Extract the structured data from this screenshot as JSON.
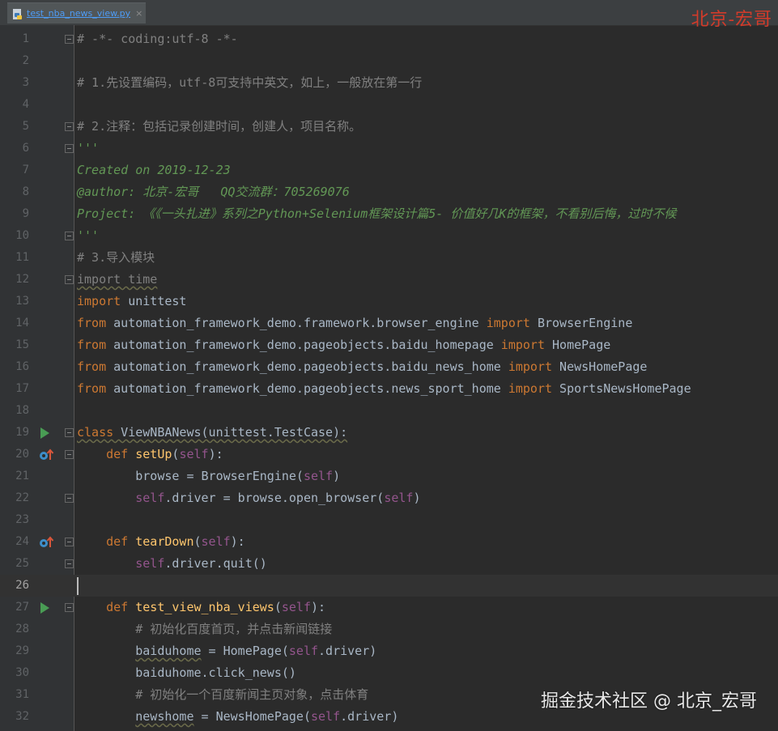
{
  "tab": {
    "title": "test_nba_news_view.py",
    "close": "×"
  },
  "watermark_top": "北京-宏哥",
  "watermark_bottom": "掘金技术社区 @ 北京_宏哥",
  "lines": [
    {
      "num": "1",
      "tokens": [
        {
          "t": "# -*- coding:utf-8 -*-",
          "c": "cm"
        }
      ]
    },
    {
      "num": "2",
      "tokens": []
    },
    {
      "num": "3",
      "tokens": [
        {
          "t": "# 1.先设置编码，utf-8可支持中英文，如上，一般放在第一行",
          "c": "cm"
        }
      ]
    },
    {
      "num": "4",
      "tokens": []
    },
    {
      "num": "5",
      "tokens": [
        {
          "t": "# 2.注释：包括记录创建时间，创建人，项目名称。",
          "c": "cm"
        }
      ]
    },
    {
      "num": "6",
      "tokens": [
        {
          "t": "'''",
          "c": "doc"
        }
      ]
    },
    {
      "num": "7",
      "tokens": [
        {
          "t": "Created on 2019-12-23",
          "c": "doc"
        }
      ]
    },
    {
      "num": "8",
      "tokens": [
        {
          "t": "@author: 北京-宏哥   QQ交流群：705269076",
          "c": "doc"
        }
      ]
    },
    {
      "num": "9",
      "tokens": [
        {
          "t": "Project: 《《一头扎进》系列之Python+Selenium框架设计篇5- 价值好几K的框架，不看别后悔，过时不候",
          "c": "doc"
        }
      ]
    },
    {
      "num": "10",
      "tokens": [
        {
          "t": "'''",
          "c": "doc"
        }
      ]
    },
    {
      "num": "11",
      "tokens": [
        {
          "t": "# 3.导入模块",
          "c": "cm"
        }
      ]
    },
    {
      "num": "12",
      "tokens": [
        {
          "t": "import time",
          "c": "cm wavy"
        }
      ]
    },
    {
      "num": "13",
      "tokens": [
        {
          "t": "import",
          "c": "kw"
        },
        {
          "t": " unittest",
          "c": "txt"
        }
      ]
    },
    {
      "num": "14",
      "tokens": [
        {
          "t": "from",
          "c": "kw"
        },
        {
          "t": " automation_framework_demo.framework.browser_engine ",
          "c": "txt"
        },
        {
          "t": "import",
          "c": "kw"
        },
        {
          "t": " BrowserEngine",
          "c": "txt"
        }
      ]
    },
    {
      "num": "15",
      "tokens": [
        {
          "t": "from",
          "c": "kw"
        },
        {
          "t": " automation_framework_demo.pageobjects.baidu_homepage ",
          "c": "txt"
        },
        {
          "t": "import",
          "c": "kw"
        },
        {
          "t": " HomePage",
          "c": "txt"
        }
      ]
    },
    {
      "num": "16",
      "tokens": [
        {
          "t": "from",
          "c": "kw"
        },
        {
          "t": " automation_framework_demo.pageobjects.baidu_news_home ",
          "c": "txt"
        },
        {
          "t": "import",
          "c": "kw"
        },
        {
          "t": " NewsHomePage",
          "c": "txt"
        }
      ]
    },
    {
      "num": "17",
      "tokens": [
        {
          "t": "from",
          "c": "kw"
        },
        {
          "t": " automation_framework_demo.pageobjects.news_sport_home ",
          "c": "txt"
        },
        {
          "t": "import",
          "c": "kw"
        },
        {
          "t": " SportsNewsHomePage",
          "c": "txt"
        }
      ]
    },
    {
      "num": "18",
      "tokens": []
    },
    {
      "num": "19",
      "tokens": [
        {
          "t": "class",
          "c": "kw wavy"
        },
        {
          "t": " ViewNBANews(unittest.TestCase):",
          "c": "txt wavy"
        }
      ]
    },
    {
      "num": "20",
      "tokens": [
        {
          "t": "    def ",
          "c": "kw"
        },
        {
          "t": "setUp",
          "c": "fn"
        },
        {
          "t": "(",
          "c": "txt"
        },
        {
          "t": "self",
          "c": "self"
        },
        {
          "t": "):",
          "c": "txt"
        }
      ]
    },
    {
      "num": "21",
      "tokens": [
        {
          "t": "        browse = BrowserEngine(",
          "c": "txt"
        },
        {
          "t": "self",
          "c": "self"
        },
        {
          "t": ")",
          "c": "txt"
        }
      ]
    },
    {
      "num": "22",
      "tokens": [
        {
          "t": "        ",
          "c": "txt"
        },
        {
          "t": "self",
          "c": "self"
        },
        {
          "t": ".driver = browse.open_browser(",
          "c": "txt"
        },
        {
          "t": "self",
          "c": "self"
        },
        {
          "t": ")",
          "c": "txt"
        }
      ]
    },
    {
      "num": "23",
      "tokens": []
    },
    {
      "num": "24",
      "tokens": [
        {
          "t": "    def ",
          "c": "kw"
        },
        {
          "t": "tearDown",
          "c": "fn"
        },
        {
          "t": "(",
          "c": "txt"
        },
        {
          "t": "self",
          "c": "self"
        },
        {
          "t": "):",
          "c": "txt"
        }
      ]
    },
    {
      "num": "25",
      "tokens": [
        {
          "t": "        ",
          "c": "txt"
        },
        {
          "t": "self",
          "c": "self"
        },
        {
          "t": ".driver.quit()",
          "c": "txt"
        }
      ]
    },
    {
      "num": "26",
      "tokens": []
    },
    {
      "num": "27",
      "tokens": [
        {
          "t": "    def ",
          "c": "kw"
        },
        {
          "t": "test_view_nba_views",
          "c": "fn"
        },
        {
          "t": "(",
          "c": "txt"
        },
        {
          "t": "self",
          "c": "self"
        },
        {
          "t": "):",
          "c": "txt"
        }
      ]
    },
    {
      "num": "28",
      "tokens": [
        {
          "t": "        # 初始化百度首页，并点击新闻链接",
          "c": "cm"
        }
      ]
    },
    {
      "num": "29",
      "tokens": [
        {
          "t": "        ",
          "c": "txt"
        },
        {
          "t": "baiduhome",
          "c": "txt wavy"
        },
        {
          "t": " = HomePage(",
          "c": "txt"
        },
        {
          "t": "self",
          "c": "self"
        },
        {
          "t": ".driver)",
          "c": "txt"
        }
      ]
    },
    {
      "num": "30",
      "tokens": [
        {
          "t": "        baiduhome.click_news()",
          "c": "txt"
        }
      ]
    },
    {
      "num": "31",
      "tokens": [
        {
          "t": "        # 初始化一个百度新闻主页对象，点击体育",
          "c": "cm"
        }
      ]
    },
    {
      "num": "32",
      "tokens": [
        {
          "t": "        ",
          "c": "txt"
        },
        {
          "t": "newshome",
          "c": "txt wavy"
        },
        {
          "t": " = NewsHomePage(",
          "c": "txt"
        },
        {
          "t": "self",
          "c": "self"
        },
        {
          "t": ".driver)",
          "c": "txt"
        }
      ]
    }
  ],
  "current_line": "26",
  "gutter_icons": {
    "run": [
      "19",
      "27"
    ],
    "override": [
      "20",
      "24"
    ],
    "fold": [
      "1",
      "5",
      "6",
      "10",
      "12",
      "19",
      "20",
      "22",
      "24",
      "25",
      "27"
    ]
  },
  "colors": {
    "background": "#2b2b2b",
    "keyword": "#cc7832",
    "function": "#ffc66d",
    "self": "#94558d",
    "comment": "#808080",
    "docstring": "#629755",
    "text": "#a9b7c6"
  }
}
